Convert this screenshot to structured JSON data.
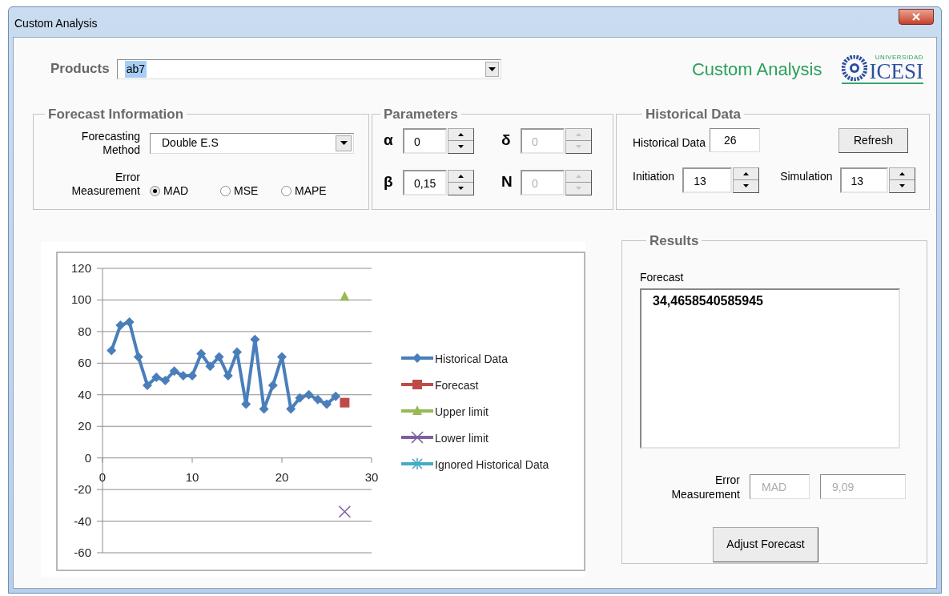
{
  "window": {
    "title": "Custom Analysis"
  },
  "products": {
    "label": "Products",
    "value": "ab7",
    "highlighted": true
  },
  "header": {
    "title": "Custom Analysis",
    "logo_small": "UNIVERSIDAD",
    "logo_text": "ICESI"
  },
  "forecast_information": {
    "title": "Forecast Information",
    "method_label": "Forecasting Method",
    "method": "Double E.S",
    "error_label": "Error Measurement",
    "error_options": [
      {
        "label": "MAD",
        "selected": true
      },
      {
        "label": "MSE",
        "selected": false
      },
      {
        "label": "MAPE",
        "selected": false
      }
    ]
  },
  "parameters": {
    "title": "Parameters",
    "items": [
      {
        "symbol": "α",
        "value": "0",
        "disabled": false
      },
      {
        "symbol": "δ",
        "value": "0",
        "disabled": true
      },
      {
        "symbol": "β",
        "value": "0,15",
        "disabled": false
      },
      {
        "symbol": "N",
        "value": "0",
        "disabled": true
      }
    ]
  },
  "historical_data": {
    "title": "Historical Data",
    "count_label": "Historical Data",
    "count": "26",
    "refresh_button": "Refresh",
    "initiation_label": "Initiation",
    "initiation": "13",
    "simulation_label": "Simulation",
    "simulation": "13"
  },
  "chart": {
    "chart_data": {
      "type": "line",
      "x": [
        1,
        2,
        3,
        4,
        5,
        6,
        7,
        8,
        9,
        10,
        11,
        12,
        13,
        14,
        15,
        16,
        17,
        18,
        19,
        20,
        21,
        22,
        23,
        24,
        25,
        26,
        27
      ],
      "xlim": [
        0,
        30
      ],
      "ylim": [
        -60,
        120
      ],
      "xticks": [
        {
          "value": 0,
          "label": "0"
        },
        {
          "value": 10,
          "label": "10"
        },
        {
          "value": 20,
          "label": "20"
        },
        {
          "value": 30,
          "label": "30"
        }
      ],
      "yticks": [
        {
          "value": -60,
          "label": "-60"
        },
        {
          "value": -40,
          "label": "-40"
        },
        {
          "value": -20,
          "label": "-20"
        },
        {
          "value": 0,
          "label": "0"
        },
        {
          "value": 20,
          "label": "20"
        },
        {
          "value": 40,
          "label": "40"
        },
        {
          "value": 60,
          "label": "60"
        },
        {
          "value": 80,
          "label": "80"
        },
        {
          "value": 100,
          "label": "100"
        },
        {
          "value": 120,
          "label": "120"
        }
      ],
      "grid": "horizontal",
      "legend": true,
      "series": [
        {
          "name": "Historical Data",
          "color": "#4a7ebb",
          "marker": "diamond",
          "values": [
            68,
            84,
            86,
            64,
            46,
            51,
            49,
            55,
            52,
            52,
            66,
            58,
            64,
            52,
            67,
            34,
            75,
            31,
            46,
            64,
            31,
            38,
            40,
            37,
            34,
            39,
            null
          ]
        },
        {
          "name": "Forecast",
          "color": "#be4b48",
          "marker": "square",
          "values": [
            null,
            null,
            null,
            null,
            null,
            null,
            null,
            null,
            null,
            null,
            null,
            null,
            null,
            null,
            null,
            null,
            null,
            null,
            null,
            null,
            null,
            null,
            null,
            null,
            null,
            null,
            35
          ]
        },
        {
          "name": "Upper limit",
          "color": "#98b954",
          "marker": "triangle",
          "values": [
            null,
            null,
            null,
            null,
            null,
            null,
            null,
            null,
            null,
            null,
            null,
            null,
            null,
            null,
            null,
            null,
            null,
            null,
            null,
            null,
            null,
            null,
            null,
            null,
            null,
            null,
            102
          ]
        },
        {
          "name": "Lower limit",
          "color": "#7d60a0",
          "marker": "x",
          "values": [
            null,
            null,
            null,
            null,
            null,
            null,
            null,
            null,
            null,
            null,
            null,
            null,
            null,
            null,
            null,
            null,
            null,
            null,
            null,
            null,
            null,
            null,
            null,
            null,
            null,
            null,
            -34
          ]
        },
        {
          "name": "Ignored Historical Data",
          "color": "#46aac5",
          "marker": "star",
          "values": [
            null,
            null,
            null,
            null,
            null,
            null,
            null,
            null,
            null,
            null,
            null,
            null,
            null,
            null,
            null,
            null,
            null,
            null,
            null,
            null,
            null,
            null,
            null,
            null,
            null,
            null,
            null
          ]
        }
      ]
    }
  },
  "results": {
    "title": "Results",
    "forecast_label": "Forecast",
    "forecast": "34,4658540585945",
    "error_label": "Error Measurement",
    "error_type": "MAD",
    "error_value": "9,09",
    "error_disabled": true,
    "adjust_button": "Adjust Forecast"
  }
}
